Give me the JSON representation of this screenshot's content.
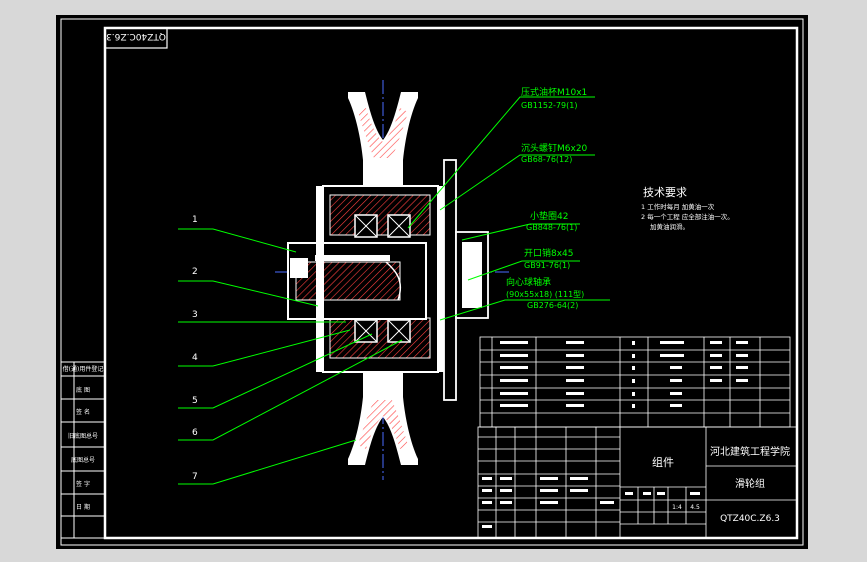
{
  "drawing": {
    "rotated_code": "QTZ40C.Z6.3",
    "title_block": {
      "org": "河北建筑工程学院",
      "part_name": "滑轮组",
      "type": "组件",
      "drawing_no": "QTZ40C.Z6.3",
      "scale": "1:4",
      "sheet": "4.5"
    }
  },
  "callouts": [
    {
      "id": "oil-cup",
      "line1": "压式油杯M10x1",
      "line2": "GB1152-79(1)"
    },
    {
      "id": "countersunk-screw",
      "line1": "沉头螺钉M6x20",
      "line2": "GB68-76(12)"
    },
    {
      "id": "washer",
      "line1": "小垫圈42",
      "line2": "GB848-76(1)"
    },
    {
      "id": "cotter-pin",
      "line1": "开口销8x45",
      "line2": "GB91-76(1)"
    },
    {
      "id": "bearing",
      "line1": "向心球轴承",
      "line2": "(90x55x18)  (111型)",
      "line3": "GB276-64(2)"
    }
  ],
  "part_numbers": [
    "1",
    "2",
    "3",
    "4",
    "5",
    "6",
    "7"
  ],
  "tech_req": {
    "title": "技术要求",
    "item1": "1 工作时每月 加黄油一次",
    "item2": "2 每一个工程 应全部注油一次。",
    "item3": "加黄油润滑。"
  },
  "left_strip": [
    "借(通)用件登记",
    "底 图",
    "签 名",
    "旧底图总号",
    "底图总号",
    "签 字",
    "日 期"
  ],
  "colors": {
    "background": "#000000",
    "frame": "#ffffff",
    "leader": "#00ff00",
    "hatch": "#ff4040",
    "centerline": "#4a6cff",
    "canvas": "#d8d8d8"
  }
}
